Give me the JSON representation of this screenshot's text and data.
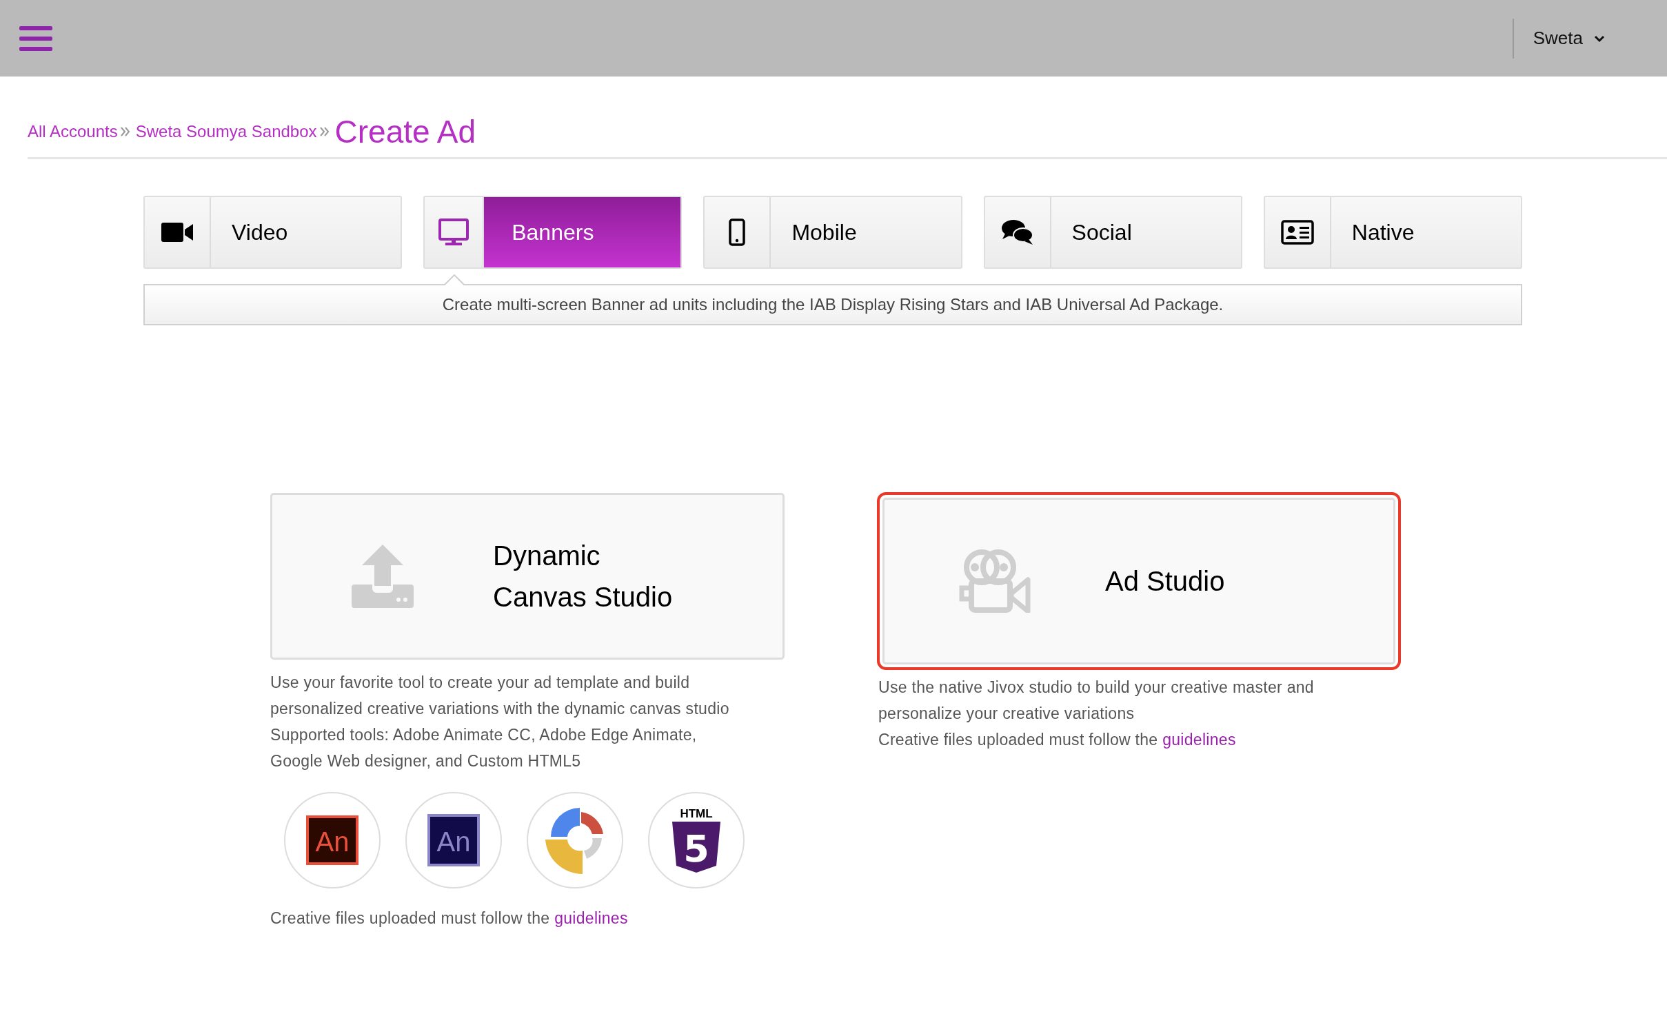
{
  "header": {
    "user": "Sweta"
  },
  "breadcrumb": [
    {
      "label": "All Accounts"
    },
    {
      "label": "Sweta Soumya Sandbox"
    }
  ],
  "page_title": "Create Ad",
  "tabs": [
    {
      "kind": "video",
      "label": "Video",
      "selected": false
    },
    {
      "kind": "banners",
      "label": "Banners",
      "selected": true
    },
    {
      "kind": "mobile",
      "label": "Mobile",
      "selected": false
    },
    {
      "kind": "social",
      "label": "Social",
      "selected": false
    },
    {
      "kind": "native",
      "label": "Native",
      "selected": false
    }
  ],
  "tab_description": "Create multi-screen Banner ad units including the IAB Display Rising Stars and IAB Universal Ad Package.",
  "cards": [
    {
      "kind": "upload",
      "title_lines": [
        "Dynamic",
        "Canvas Studio"
      ],
      "selected": false,
      "description_lines": [
        "Use your favorite tool to create your ad template and build",
        "personalized creative variations with the dynamic canvas studio",
        "Supported tools: Adobe Animate CC, Adobe Edge Animate,",
        "Google Web designer, and Custom HTML5"
      ],
      "tools": [
        {
          "kind": "animate",
          "label": "An"
        },
        {
          "kind": "edge",
          "label": "An"
        },
        {
          "kind": "webdesigner"
        },
        {
          "kind": "html5",
          "label": "HTML",
          "mark": "5"
        }
      ],
      "guideline": {
        "text": "Creative files uploaded must follow the",
        "link": "guidelines"
      }
    },
    {
      "kind": "studio",
      "title_lines": [
        "Ad Studio"
      ],
      "selected": true,
      "description_lines": [
        "Use the native Jivox studio to build your creative master and",
        "personalize your creative variations"
      ],
      "guideline": {
        "text": "Creative files uploaded must follow the",
        "link": "guidelines"
      }
    }
  ]
}
